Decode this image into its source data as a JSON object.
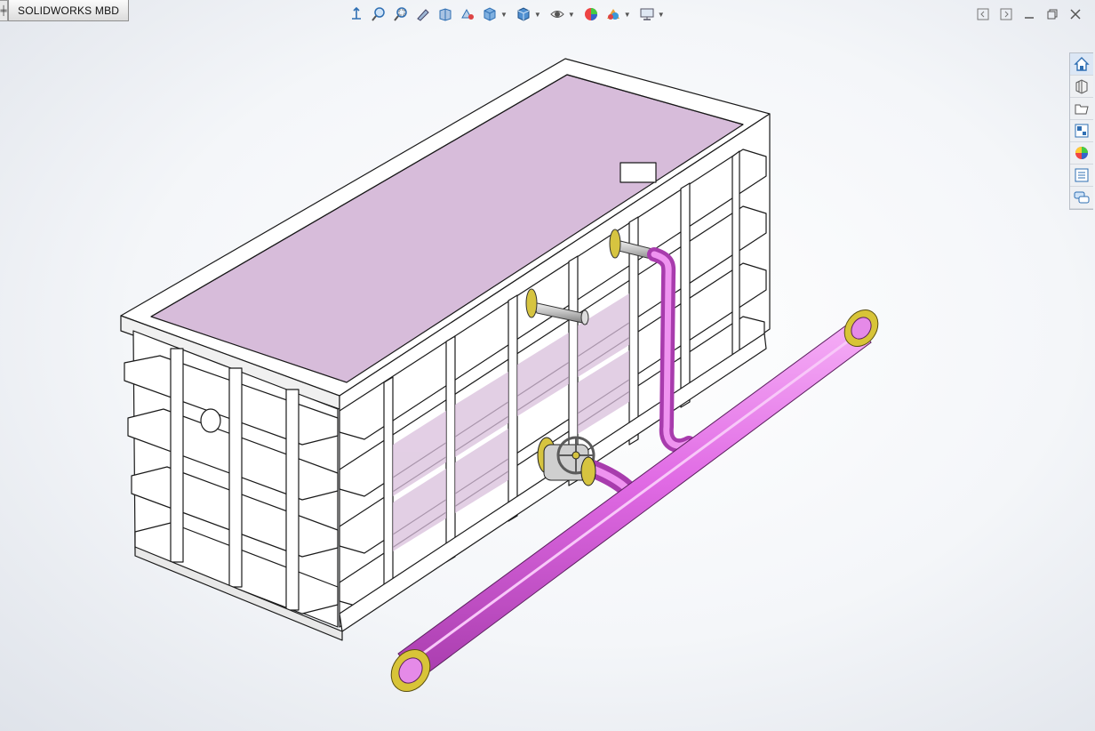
{
  "window": {
    "tab_label": "SOLIDWORKS MBD",
    "tab_edge_glyph": "╪"
  },
  "heads_up_toolbar": [
    {
      "name": "view-orientation-icon"
    },
    {
      "name": "zoom-to-fit-icon"
    },
    {
      "name": "zoom-to-area-icon"
    },
    {
      "name": "previous-view-icon"
    },
    {
      "name": "section-view-icon"
    },
    {
      "name": "dynamic-annotation-icon"
    },
    {
      "name": "view-orientation-cube-icon",
      "dropdown": true
    },
    {
      "name": "display-style-icon",
      "dropdown": true
    },
    {
      "name": "hide-show-items-icon",
      "dropdown": true
    },
    {
      "name": "edit-appearance-icon"
    },
    {
      "name": "apply-scene-icon",
      "dropdown": true
    },
    {
      "name": "view-settings-icon",
      "dropdown": true
    }
  ],
  "window_controls": [
    "tile-left-icon",
    "tile-right-icon",
    "minimize-icon",
    "restore-icon",
    "close-icon"
  ],
  "task_pane": [
    "home-icon",
    "design-library-icon",
    "file-explorer-icon",
    "view-palette-icon",
    "appearances-scenes-icon",
    "custom-properties-icon",
    "forum-icon"
  ],
  "colors": {
    "pipe": "#e268e6",
    "tank_interior": "#d9bfdc",
    "flange": "#c9b52a",
    "accent": "#2f6fb3"
  }
}
